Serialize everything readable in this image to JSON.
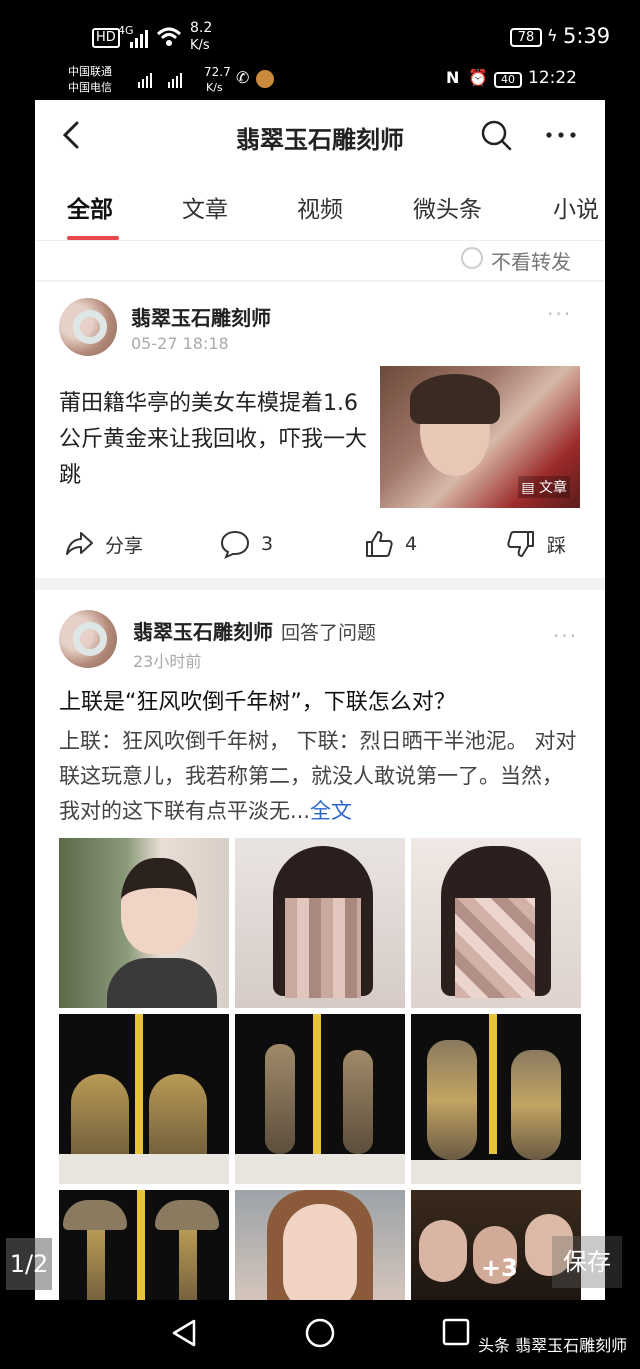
{
  "outer_status": {
    "hd": "HD",
    "signal": "4G",
    "speed_value": "8.2",
    "speed_unit": "K/s",
    "battery": "78",
    "time": "5:39"
  },
  "inner_status": {
    "carrier1": "中国联通",
    "carrier2": "中国电信",
    "speed_value": "72.7",
    "speed_unit": "K/s",
    "battery": "40",
    "time": "12:22"
  },
  "navbar": {
    "title": "翡翠玉石雕刻师"
  },
  "tabs": [
    {
      "label": "全部",
      "active": true
    },
    {
      "label": "文章"
    },
    {
      "label": "视频"
    },
    {
      "label": "微头条"
    },
    {
      "label": "小说"
    }
  ],
  "filter": {
    "label": "不看转发"
  },
  "post1": {
    "author": "翡翠玉石雕刻师",
    "time": "05-27 18:18",
    "text": "莆田籍华亭的美女车模提着1.6公斤黄金来让我回收，吓我一大跳",
    "thumb_badge": "文章",
    "share_label": "分享",
    "comment_count": "3",
    "like_count": "4",
    "dislike_label": "踩"
  },
  "post2": {
    "author": "翡翠玉石雕刻师",
    "action": "回答了问题",
    "time": "23小时前",
    "question": "上联是“狂风吹倒千年树”，下联怎么对？",
    "body": "上联：狂风吹倒千年树，  下联：烈日晒干半池泥。 对对联这玩意儿，我若称第二，就没人敢说第一了。当然，我对的这下联有点平淡无...",
    "full_text_link": "全文",
    "more_images": "+3"
  },
  "overlay": {
    "page_indicator": "1/2",
    "save_label": "保存"
  },
  "watermark": "头条 翡翠玉石雕刻师"
}
